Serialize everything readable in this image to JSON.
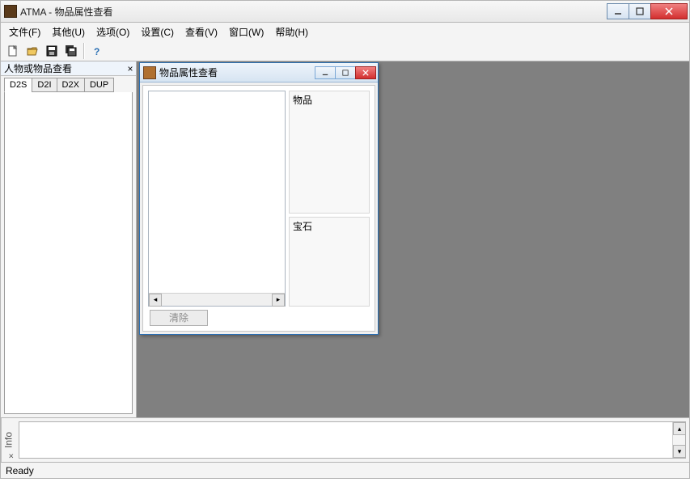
{
  "window": {
    "title": "ATMA - 物品属性查看"
  },
  "menu": {
    "file": "文件(F)",
    "other": "其他(U)",
    "options": "选项(O)",
    "settings": "设置(C)",
    "view": "查看(V)",
    "window": "窗口(W)",
    "help": "帮助(H)"
  },
  "left_pane": {
    "title": "人物或物品查看",
    "close": "×",
    "tabs": [
      "D2S",
      "D2I",
      "D2X",
      "DUP"
    ]
  },
  "child_window": {
    "title": "物品属性查看",
    "section_item": "物品",
    "section_gem": "宝石",
    "clear_button": "清除"
  },
  "info_pane": {
    "label": "Info",
    "close": "×"
  },
  "status": {
    "text": "Ready"
  }
}
